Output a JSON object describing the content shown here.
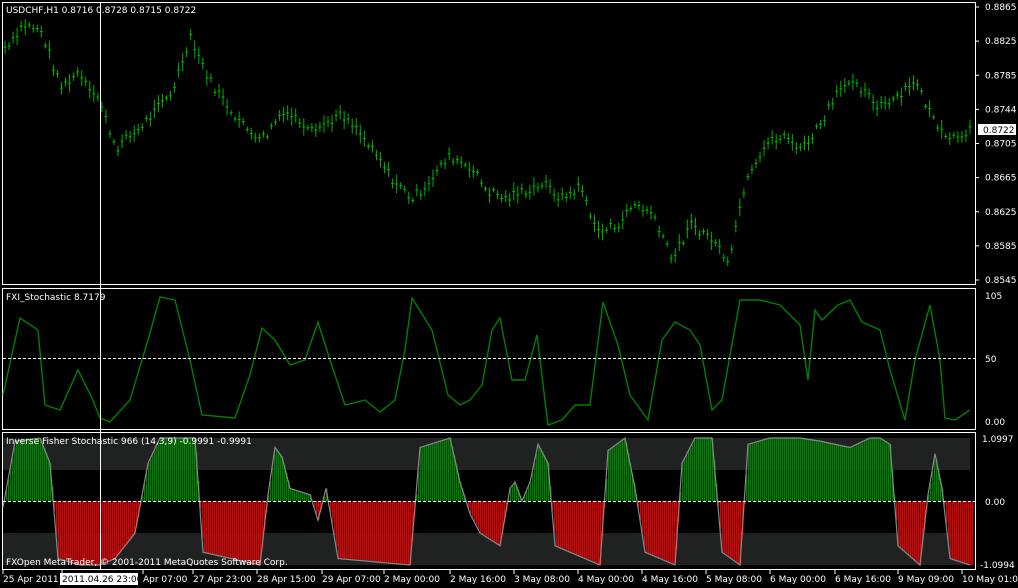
{
  "price_panel": {
    "title": "USDCHF,H1  0.8716 0.8728 0.8715 0.8722",
    "y_ticks": [
      "0.8865",
      "0.8825",
      "0.8785",
      "0.8744",
      "0.8705",
      "0.8665",
      "0.8625",
      "0.8585",
      "0.8545"
    ],
    "current": "0.8722",
    "color": "#00b000"
  },
  "stoch_panel": {
    "title": "FXI_Stochastic 8.7179",
    "y_ticks": [
      "105",
      "50",
      "0.00"
    ],
    "color": "#008000"
  },
  "ifish_panel": {
    "title": "Inverse Fisher Stochastic 966 (14,3,9) -0.9991 -0.9991",
    "y_ticks": [
      "1.0997",
      "0.00",
      "-1.0994"
    ],
    "up_color": "#008000",
    "down_color": "#e00000",
    "footer": "FXOpen MetaTrader, © 2001-2011 MetaQuotes Software Corp."
  },
  "time_axis": {
    "labels": [
      "25 Apr 2011",
      "2011.04.26 23:00",
      "Apr 07:00",
      "27 Apr 23:00",
      "28 Apr 15:00",
      "29 Apr 07:00",
      "2 May 00:00",
      "2 May 16:00",
      "3 May 08:00",
      "4 May 00:00",
      "4 May 16:00",
      "5 May 08:00",
      "6 May 00:00",
      "6 May 16:00",
      "9 May 09:00",
      "10 May 01:00"
    ]
  },
  "chart_data": {
    "type": "line",
    "title": "USDCHF,H1",
    "ylim": [
      0.8545,
      0.8865
    ],
    "series": [
      {
        "name": "USDCHF,H1",
        "values": [
          0.8818,
          0.8845,
          0.8835,
          0.877,
          0.879,
          0.876,
          0.87,
          0.8718,
          0.874,
          0.8765,
          0.8832,
          0.878,
          0.875,
          0.8722,
          0.8712,
          0.8745,
          0.873,
          0.8725,
          0.8738,
          0.872,
          0.869,
          0.866,
          0.864,
          0.8665,
          0.869,
          0.868,
          0.865,
          0.864,
          0.865,
          0.8658,
          0.864,
          0.8655,
          0.86,
          0.861,
          0.8635,
          0.862,
          0.857,
          0.861,
          0.8595,
          0.857,
          0.867,
          0.8705,
          0.8712,
          0.87,
          0.873,
          0.8775,
          0.877,
          0.875,
          0.876,
          0.878,
          0.8735,
          0.8712,
          0.8722
        ]
      }
    ]
  }
}
